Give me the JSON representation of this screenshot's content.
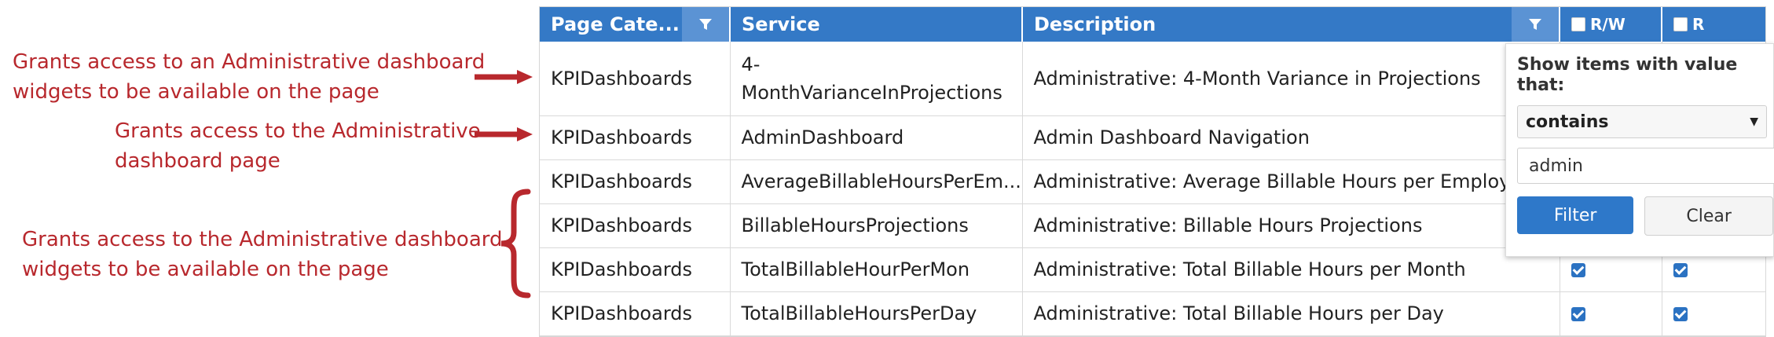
{
  "annotations": [
    {
      "line1": "Grants access to an Administrative dashboard",
      "line2": "widgets to be available on the page"
    },
    {
      "line1": "Grants access to the Administrative",
      "line2": "dashboard page"
    },
    {
      "line1": "Grants access to the Administrative dashboard",
      "line2": "widgets to be available on the page"
    }
  ],
  "annotation_color": "#b8282d",
  "header_color": "#3479c6",
  "table": {
    "headers": {
      "category": "Page Cate...",
      "service": "Service",
      "description": "Description",
      "rw": "R/W",
      "r": "R"
    },
    "rows": [
      {
        "category": "KPIDashboards",
        "service": "4-MonthVarianceInProjections",
        "description": "Administrative: 4-Month Variance in Projections",
        "rw": true,
        "r": true
      },
      {
        "category": "KPIDashboards",
        "service": "AdminDashboard",
        "description": "Admin Dashboard Navigation",
        "rw": true,
        "r": true
      },
      {
        "category": "KPIDashboards",
        "service": "AverageBillableHoursPerEm...",
        "description": "Administrative: Average Billable Hours per Employee",
        "rw": true,
        "r": true
      },
      {
        "category": "KPIDashboards",
        "service": "BillableHoursProjections",
        "description": "Administrative: Billable Hours Projections",
        "rw": true,
        "r": true
      },
      {
        "category": "KPIDashboards",
        "service": "TotalBillableHourPerMon",
        "description": "Administrative: Total Billable Hours per Month",
        "rw": true,
        "r": true
      },
      {
        "category": "KPIDashboards",
        "service": "TotalBillableHoursPerDay",
        "description": "Administrative: Total Billable Hours per Day",
        "rw": true,
        "r": true
      }
    ]
  },
  "filter_popup": {
    "title": "Show items with value that:",
    "operator": "contains",
    "value": "admin",
    "filter_label": "Filter",
    "clear_label": "Clear"
  }
}
